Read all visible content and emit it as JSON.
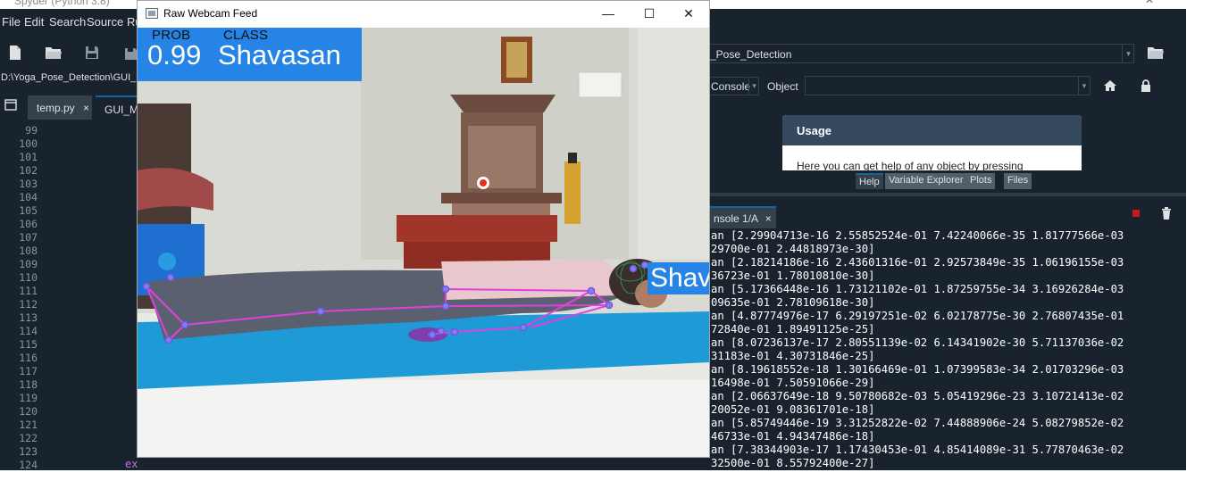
{
  "spyder": {
    "title": "Spyder (Python 3.8)",
    "menu": [
      "File",
      "Edit",
      "Search",
      "Source",
      "Ru"
    ],
    "path": "D:\\Yoga_Pose_Detection\\GUI_M",
    "tabs": [
      {
        "label": "temp.py",
        "close": "×"
      },
      {
        "label": "GUI_Ma"
      }
    ],
    "line_numbers": [
      "99",
      "100",
      "101",
      "102",
      "103",
      "104",
      "105",
      "106",
      "107",
      "108",
      "109",
      "110",
      "111",
      "112",
      "113",
      "114",
      "115",
      "116",
      "117",
      "118",
      "119",
      "120",
      "121",
      "122",
      "123",
      "124"
    ],
    "code_fragment": "ex",
    "working_dir": "_Pose_Detection",
    "help": {
      "source": "Console",
      "object_label": "Object",
      "usage_title": "Usage",
      "usage_text": "Here you can get help of any object by pressing",
      "tabs": [
        "Help",
        "Variable Explorer",
        "Plots",
        "Files"
      ]
    },
    "console": {
      "tab_label": "nsole 1/A",
      "tab_close": "×",
      "lines": [
        "an [2.29904713e-16 2.55852524e-01 7.42240066e-35 1.81777566e-03",
        "29700e-01 2.44818973e-30]",
        "an [2.18214186e-16 2.43601316e-01 2.92573849e-35 1.06196155e-03",
        "36723e-01 1.78010810e-30]",
        "an [5.17366448e-16 1.73121102e-01 1.87259755e-34 3.16926284e-03",
        "09635e-01 2.78109618e-30]",
        "an [4.87774976e-17 6.29197251e-02 6.02178775e-30 2.76807435e-01",
        "72840e-01 1.89491125e-25]",
        "an [8.07236137e-17 2.80551139e-02 6.14341902e-30 5.71137036e-02",
        "31183e-01 4.30731846e-25]",
        "an [8.19618552e-18 1.30166469e-01 1.07399583e-34 2.01703296e-03",
        "16498e-01 7.50591066e-29]",
        "an [2.06637649e-18 9.50780682e-03 5.05419296e-23 3.10721413e-02",
        "20052e-01 9.08361701e-18]",
        "an [5.85749446e-19 3.31252822e-02 7.44888906e-24 5.08279852e-02",
        "46733e-01 4.94347486e-18]",
        "an [7.38344903e-17 1.17430453e-01 4.85414089e-31 5.77870463e-02",
        "32500e-01 8.55792400e-27]"
      ]
    }
  },
  "webcam": {
    "title": "Raw Webcam Feed",
    "controls": {
      "minimize": "—",
      "maximize": "☐",
      "close": "✕"
    },
    "overlay": {
      "prob_label": "PROB",
      "class_label": "CLASS",
      "prob_value": "0.99",
      "class_value": "Shavasan",
      "head_label": "Shavasan"
    }
  },
  "colors": {
    "spyder_bg": "#19232d",
    "overlay_blue": "#2684e6",
    "skeleton": "#e040e0",
    "mat_blue": "#1e9ad6"
  }
}
